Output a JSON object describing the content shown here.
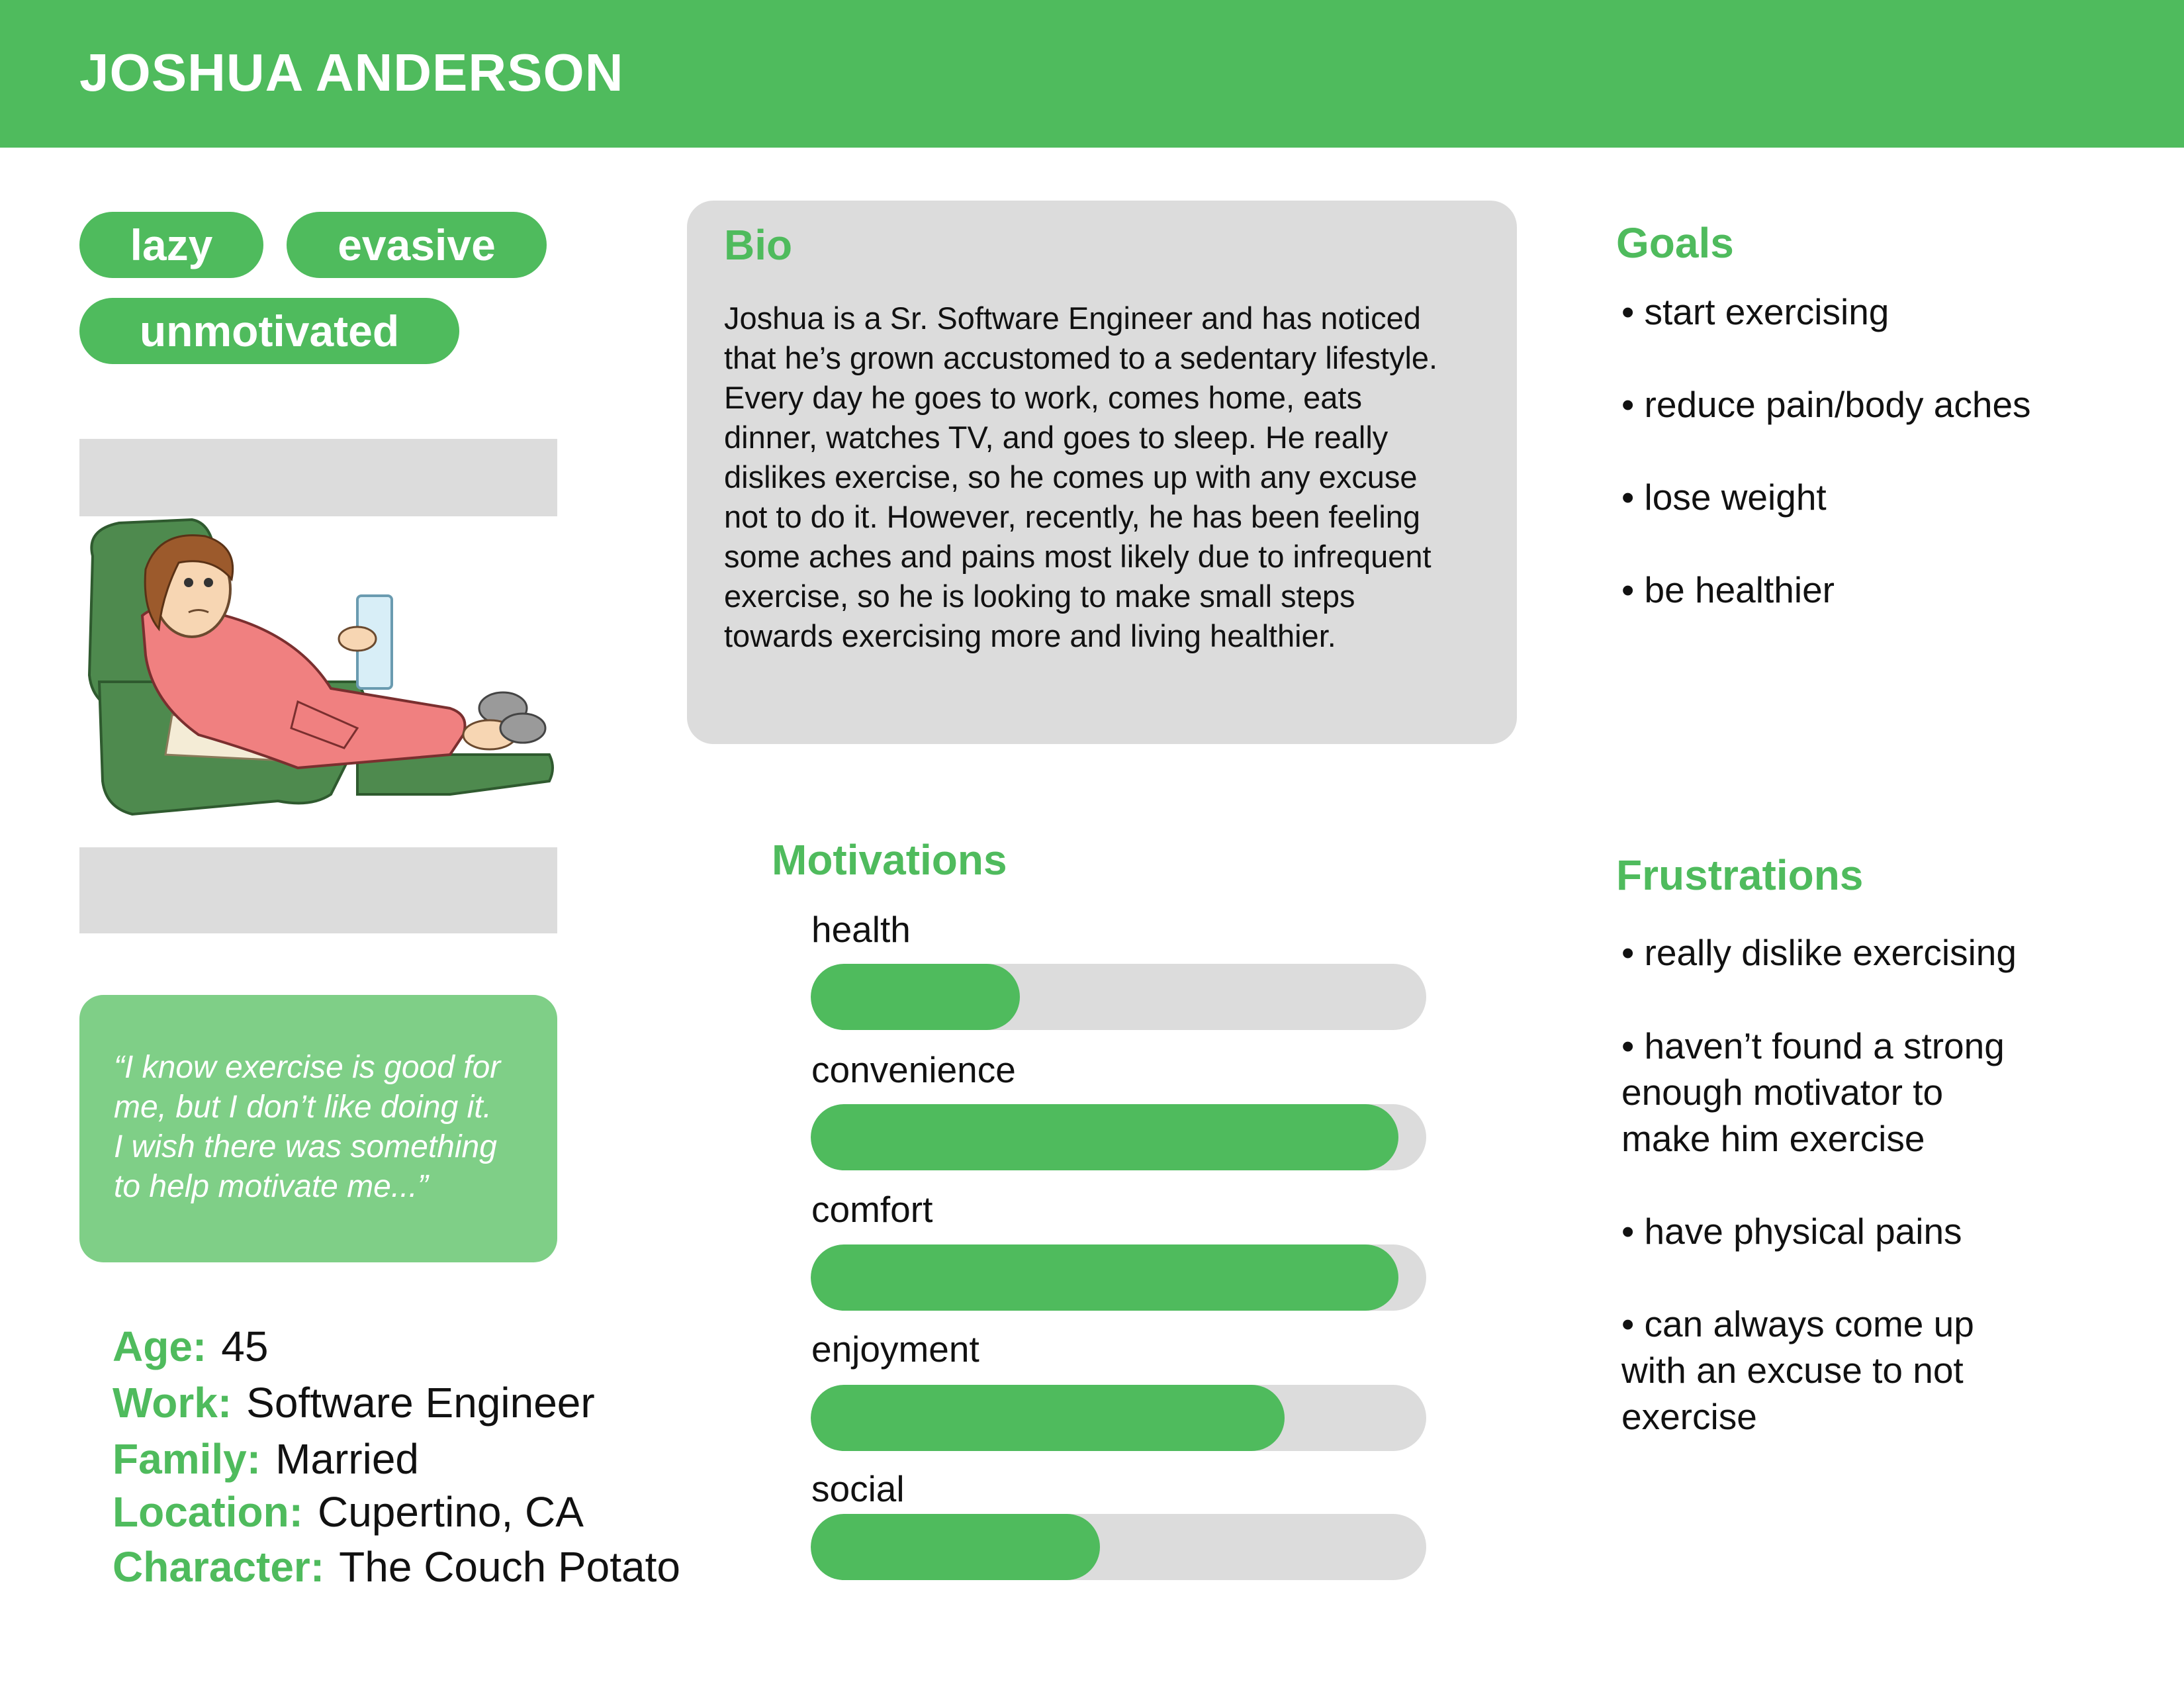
{
  "header": {
    "name": "JOSHUA ANDERSON"
  },
  "tags": [
    "lazy",
    "evasive",
    "unmotivated"
  ],
  "quote": "“I know exercise is good for\nme, but I don’t like doing it.\nI wish there was something\nto help motivate me...”",
  "info": [
    {
      "label": "Age:",
      "value": "45"
    },
    {
      "label": "Work:",
      "value": "Software Engineer"
    },
    {
      "label": "Family:",
      "value": "Married"
    },
    {
      "label": "Location:",
      "value": "Cupertino, CA"
    },
    {
      "label": "Character:",
      "value": "The Couch Potato"
    }
  ],
  "bio": {
    "heading": "Bio",
    "text": "Joshua is a Sr. Software Engineer and has noticed\nthat he’s grown accustomed to a sedentary lifestyle.\nEvery day he goes to work, comes home, eats\ndinner, watches TV, and goes to sleep. He really\ndislikes exercise, so he comes up with any excuse\nnot to do it. However, recently, he has been feeling\nsome aches and pains most likely due to infrequent\nexercise, so he is looking to make small steps\ntowards exercising more and living healthier."
  },
  "motivations": {
    "heading": "Motivations",
    "items": [
      {
        "label": "health",
        "level": 0.34
      },
      {
        "label": "convenience",
        "level": 0.955
      },
      {
        "label": "comfort",
        "level": 0.955
      },
      {
        "label": "enjoyment",
        "level": 0.77
      },
      {
        "label": "social",
        "level": 0.47
      }
    ]
  },
  "goals": {
    "heading": "Goals",
    "items": [
      "• start exercising",
      "• reduce pain/body aches",
      "• lose weight",
      "• be healthier"
    ]
  },
  "frustrations": {
    "heading": "Frustrations",
    "items": [
      "• really dislike exercising",
      "• haven’t found a strong\n  enough motivator to\n  make him exercise",
      "• have physical pains",
      "• can always come up\n  with an excuse to not\n  exercise"
    ]
  },
  "colors": {
    "accent": "#4fbb5d",
    "accent_light": "#7fcf87",
    "panel": "#dcdcdc"
  }
}
